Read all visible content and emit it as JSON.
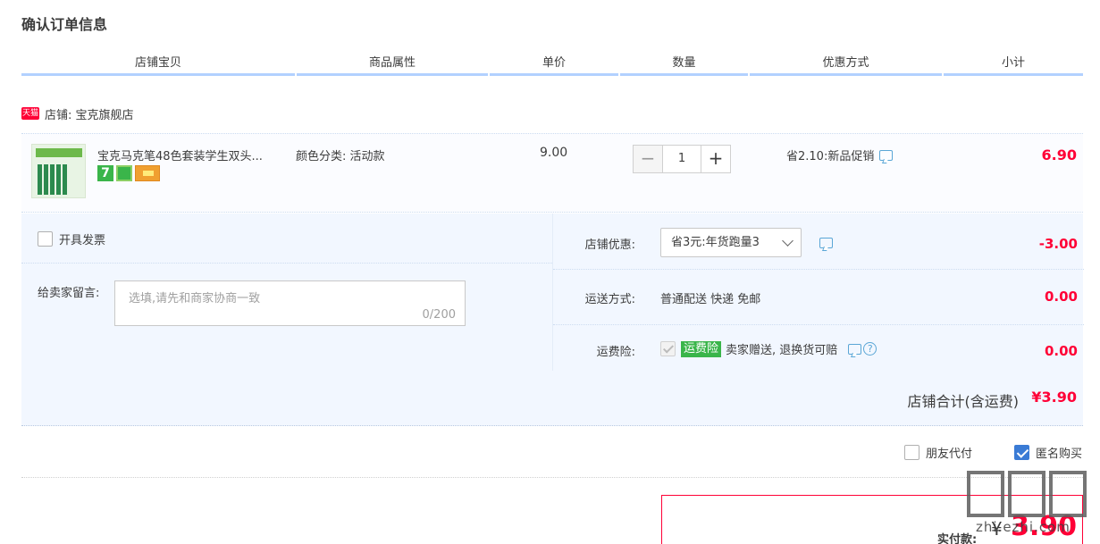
{
  "page": {
    "title": "确认订单信息"
  },
  "columns": [
    "店铺宝贝",
    "商品属性",
    "单价",
    "数量",
    "优惠方式",
    "小计"
  ],
  "shop": {
    "badge": "天猫",
    "label": "店铺: 宝克旗舰店"
  },
  "item": {
    "title": "宝克马克笔48色套装学生双头...",
    "attribute": "颜色分类: 活动款",
    "unit_price": "9.00",
    "quantity": "1",
    "quantity_minus": "−",
    "quantity_plus": "+",
    "promotion": "省2.10:新品促销",
    "subtotal": "6.90",
    "badges": {
      "seven_day": "7"
    }
  },
  "invoice": {
    "label": "开具发票",
    "checked": false
  },
  "message": {
    "label": "给卖家留言:",
    "placeholder": "选填,请先和商家协商一致",
    "counter": "0/200"
  },
  "shop_discount": {
    "label": "店铺优惠:",
    "selected": "省3元:年货跑量3",
    "amount": "-3.00"
  },
  "shipping": {
    "label": "运送方式:",
    "value": "普通配送 快递 免邮",
    "amount": "0.00"
  },
  "shipping_insurance": {
    "label": "运费险:",
    "tag": "运费险",
    "text": "卖家赠送, 退换货可赔",
    "amount": "0.00",
    "help": "?"
  },
  "shop_total": {
    "label": "店铺合计(含运费)",
    "value": "¥3.90"
  },
  "options": {
    "friend_pay": {
      "label": "朋友代付",
      "checked": false
    },
    "anonymous": {
      "label": "匿名购买",
      "checked": true
    }
  },
  "payment": {
    "label": "实付款:",
    "currency": "¥",
    "value": "3.90"
  },
  "watermark": {
    "text": "zhi.ezhi.com"
  },
  "colors": {
    "accent": "#ff0036",
    "header_border": "#b2d1ff",
    "panel_bg": "#f2f7ff",
    "tag_green": "#3ab54a"
  }
}
